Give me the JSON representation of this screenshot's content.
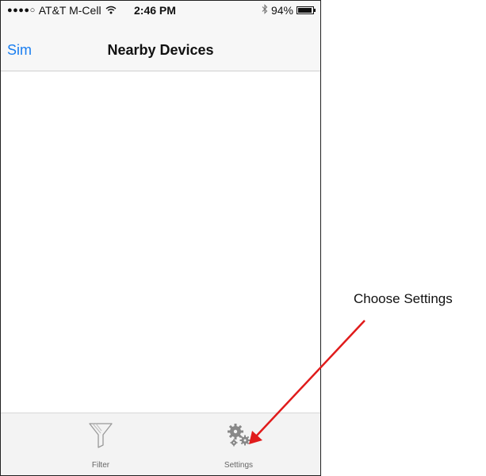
{
  "status_bar": {
    "signal": "●●●●○",
    "carrier": "AT&T M-Cell",
    "time": "2:46 PM",
    "battery_percent": "94%",
    "battery_level": 0.94
  },
  "nav_bar": {
    "back_label": "Sim",
    "title": "Nearby Devices"
  },
  "tab_bar": {
    "tabs": [
      {
        "label": "Filter",
        "icon": "filter-icon"
      },
      {
        "label": "Settings",
        "icon": "gears-icon"
      }
    ]
  },
  "annotation": {
    "text": "Choose Settings",
    "arrow_color": "#e01b1b"
  },
  "colors": {
    "accent": "#1a7ef0"
  }
}
